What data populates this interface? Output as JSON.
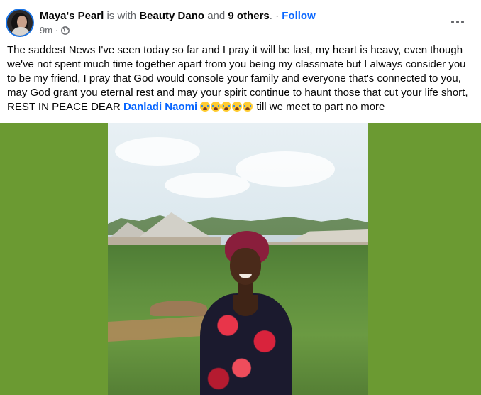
{
  "post": {
    "author": "Maya's Pearl",
    "is_with_text": "is with",
    "tagged_person": "Beauty Dano",
    "and_text": "and",
    "others": "9 others",
    "separator": ". ·",
    "follow_label": "Follow",
    "time": "9m ·",
    "text_main": "The saddest News I've seen today so far and I pray it will be last, my heart is heavy, even though we've not spent much time together apart from you being my classmate but I always consider you to be my friend, I pray that God would console your family and everyone that's connected to you, may God grant you eternal rest and may your spirit continue to haunt those that cut your life short, REST IN PEACE DEAR",
    "mention": "Danladi Naomi",
    "text_end": "till we meet to part no more",
    "emoji_count": 5
  },
  "icons": {
    "avatar": "avatar",
    "globe": "globe-icon",
    "more": "more-options-icon",
    "emoji": "crying-face-emoji"
  },
  "colors": {
    "link": "#0866ff",
    "muted": "#65676b",
    "photo_background": "#6b9a32"
  }
}
